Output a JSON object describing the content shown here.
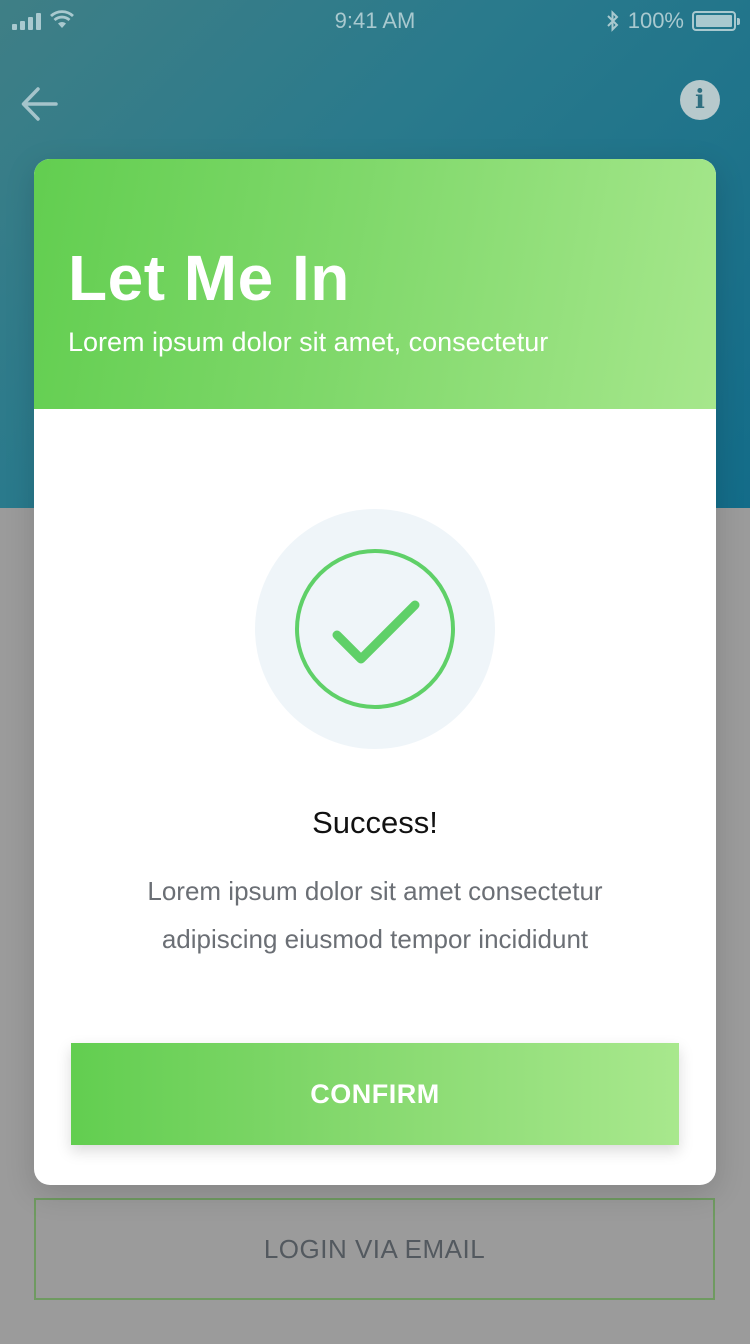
{
  "status_bar": {
    "time": "9:41 AM",
    "battery": "100%"
  },
  "background": {
    "email_button": "LOGIN VIA EMAIL"
  },
  "modal": {
    "title": "Let Me In",
    "subtitle": "Lorem ipsum dolor sit amet, consectetur",
    "success_heading": "Success!",
    "success_body": "Lorem ipsum dolor sit amet consectetur adipiscing eiusmod tempor incididunt",
    "confirm_button": "CONFIRM"
  },
  "icons": {
    "back": "back-arrow-icon",
    "info": "info-icon",
    "success": "checkmark-icon"
  },
  "colors": {
    "accent_green": "#62ce50",
    "accent_green_light": "#a6e78c",
    "header_teal": "#136c89",
    "check_green": "#5fd068"
  }
}
